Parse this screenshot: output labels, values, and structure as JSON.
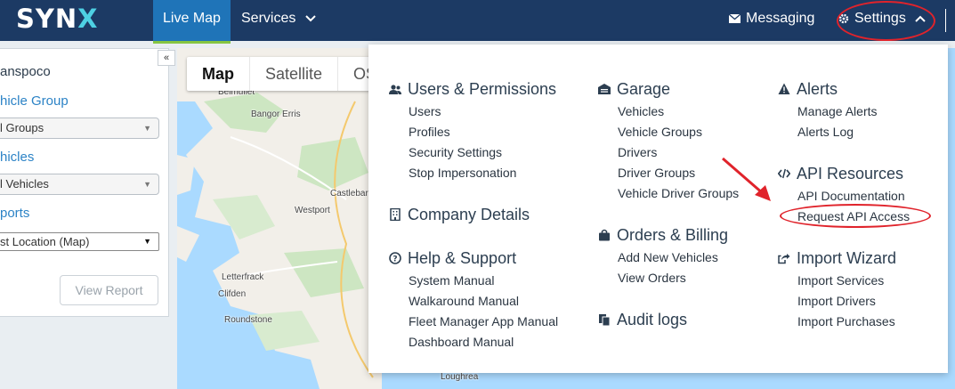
{
  "topbar": {
    "logo_text": "SYN",
    "logo_x": "X",
    "nav": {
      "live_map": "Live Map",
      "services": "Services",
      "messaging": "Messaging",
      "settings": "Settings"
    }
  },
  "sidebar": {
    "company": "anspoco",
    "vehicle_group_label": "hicle Group",
    "vehicle_group_value": "l Groups",
    "vehicles_label": "hicles",
    "vehicles_value": "l Vehicles",
    "reports_label": "ports",
    "report_value": "st Location (Map)",
    "view_report_button": "View Report",
    "collapse_glyph": "«"
  },
  "map": {
    "tabs": [
      "Map",
      "Satellite",
      "OS"
    ],
    "places": {
      "belmullet": "Belmullet",
      "bangor_erris": "Bangor Erris",
      "westport": "Westport",
      "castlebar": "Castlebar",
      "letterfrack": "Letterfrack",
      "clifden": "Clifden",
      "roundstone": "Roundstone",
      "loughrea": "Loughrea"
    }
  },
  "settings_menu": {
    "users_permissions": {
      "title": "Users & Permissions",
      "items": [
        "Users",
        "Profiles",
        "Security Settings",
        "Stop Impersonation"
      ]
    },
    "company_details": {
      "title": "Company Details"
    },
    "help_support": {
      "title": "Help & Support",
      "items": [
        "System Manual",
        "Walkaround Manual",
        "Fleet Manager App Manual",
        "Dashboard Manual"
      ]
    },
    "garage": {
      "title": "Garage",
      "items": [
        "Vehicles",
        "Vehicle Groups",
        "Drivers",
        "Driver Groups",
        "Vehicle Driver Groups"
      ]
    },
    "orders_billing": {
      "title": "Orders & Billing",
      "items": [
        "Add New Vehicles",
        "View Orders"
      ]
    },
    "audit_logs": {
      "title": "Audit logs"
    },
    "alerts": {
      "title": "Alerts",
      "items": [
        "Manage Alerts",
        "Alerts Log"
      ]
    },
    "api_resources": {
      "title": "API Resources",
      "items": [
        "API Documentation",
        "Request API Access"
      ]
    },
    "import_wizard": {
      "title": "Import Wizard",
      "items": [
        "Import Services",
        "Import Drivers",
        "Import Purchases"
      ]
    }
  },
  "colors": {
    "topbar": "#1c3a64",
    "live_map_tab": "#1f74b8",
    "annotation_red": "#e0232b",
    "link_blue": "#2c83c6"
  }
}
